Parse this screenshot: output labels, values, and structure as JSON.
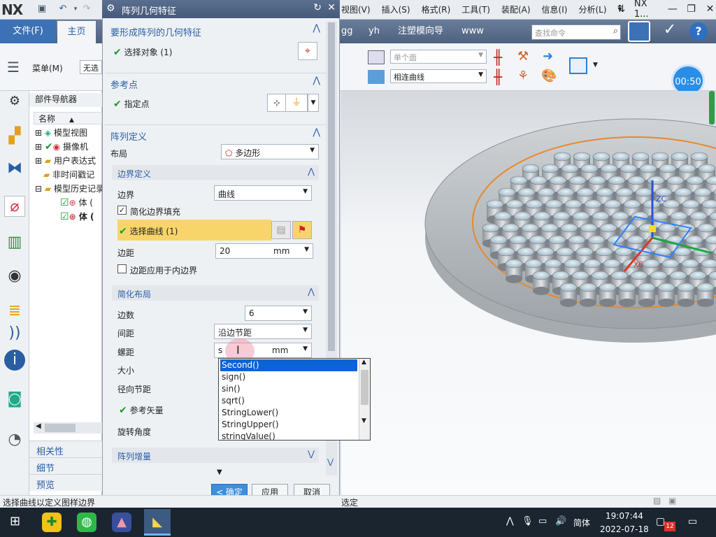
{
  "app": {
    "logo": "NX",
    "window_title": "NX 1...",
    "menu": [
      "视图(V)",
      "插入(S)",
      "格式(R)",
      "工具(T)",
      "装配(A)",
      "信息(I)",
      "分析(L)"
    ]
  },
  "ribbon": {
    "file_tab": "文件(F)",
    "home_tab": "主页",
    "tabs": [
      "gg",
      "yh",
      "注塑模向导",
      "www"
    ],
    "search_placeholder": "查找命令",
    "menu_button": "菜单(M)",
    "filter_select": "无选",
    "face_select": "单个面",
    "curve_select": "相连曲线",
    "timer": "00:50"
  },
  "navigator": {
    "title": "部件导航器",
    "column": "名称",
    "rows": [
      "模型视图",
      "摄像机",
      "用户表达式",
      "非时间戳记",
      "模型历史记录",
      "体 (",
      "体 ("
    ],
    "bottom": [
      "相关性",
      "细节",
      "预览"
    ]
  },
  "dialog": {
    "title": "阵列几何特征",
    "sec_geometry": "要形成阵列的几何特征",
    "select_object": "选择对象 (1)",
    "sec_ref": "参考点",
    "specify_point": "指定点",
    "sec_pattern": "阵列定义",
    "layout_label": "布局",
    "layout_value": "多边形",
    "sec_boundary": "边界定义",
    "boundary_label": "边界",
    "boundary_value": "曲线",
    "simplify_fill": "简化边界填充",
    "select_curve": "选择曲线 (1)",
    "margin_label": "边距",
    "margin_value": "20",
    "margin_unit": "mm",
    "margin_inner": "边距应用于内边界",
    "sec_simple": "简化布局",
    "sides_label": "边数",
    "sides_value": "6",
    "spacing_label": "间距",
    "spacing_value": "沿边节距",
    "pitch_label": "螺距",
    "pitch_value": "s",
    "pitch_unit": "mm",
    "size_label": "大小",
    "radial_label": "径向节距",
    "ref_vector": "参考矢量",
    "rotate_label": "旋转角度",
    "sec_increment": "阵列增量",
    "ok": "< 确定 >",
    "apply": "应用",
    "cancel": "取消"
  },
  "autocomplete": {
    "items": [
      "Second()",
      "sign()",
      "sin()",
      "sqrt()",
      "StringLower()",
      "StringUpper()",
      "stringValue()"
    ],
    "selected_index": 0
  },
  "status": {
    "prompt": "选择曲线以定义图样边界",
    "right": "选定"
  },
  "taskbar": {
    "ime": "简体",
    "time": "19:07:44",
    "date": "2022-07-18",
    "notif": "12"
  },
  "colors": {
    "accent": "#2a5ea2",
    "selection": "#0a64d8",
    "highlight_row": "#f8d56b",
    "orange_boundary": "#e8882a"
  }
}
